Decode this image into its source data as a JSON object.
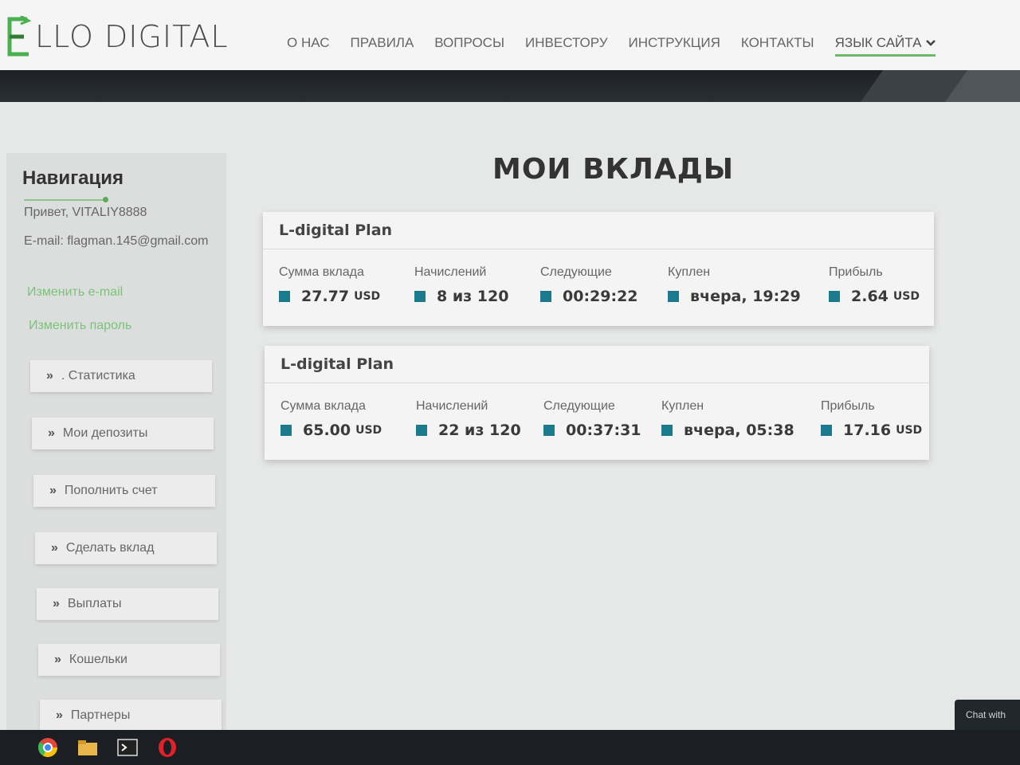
{
  "header": {
    "logo_text": "LLO DIGITAL",
    "nav": [
      "О НАС",
      "ПРАВИЛА",
      "ВОПРОСЫ",
      "ИНВЕСТОРУ",
      "ИНСТРУКЦИЯ",
      "КОНТАКТЫ"
    ],
    "language_label": "ЯЗЫК САЙТА"
  },
  "sidebar": {
    "title": "Навигация",
    "greeting": "Привет, VITALIY8888",
    "email": "E-mail: flagman.145@gmail.com",
    "change_email": "Изменить e-mail",
    "change_password": "Изменить пароль",
    "menu": [
      {
        "label": ". Статистика"
      },
      {
        "label": "Мои депозиты"
      },
      {
        "label": "Пополнить счет"
      },
      {
        "label": "Сделать вклад"
      },
      {
        "label": "Выплаты"
      },
      {
        "label": "Кошельки"
      },
      {
        "label": "Партнеры"
      }
    ]
  },
  "main": {
    "title": "МОИ ВКЛАДЫ",
    "labels": {
      "amount": "Сумма вклада",
      "accruals": "Начислений",
      "next": "Следующие",
      "bought": "Куплен",
      "profit": "Прибыль"
    },
    "deposits": [
      {
        "plan": "L-digital Plan",
        "amount": "27.77",
        "currency": "USD",
        "accruals": "8 из 120",
        "next": "00:29:22",
        "bought": "вчера, 19:29",
        "profit": "2.64"
      },
      {
        "plan": "L-digital Plan",
        "amount": "65.00",
        "currency": "USD",
        "accruals": "22 из 120",
        "next": "00:37:31",
        "bought": "вчера, 05:38",
        "profit": "17.16"
      }
    ]
  },
  "chat_widget": "Chat with",
  "colors": {
    "accent": "#6db96b",
    "marker": "#1a7b8c",
    "band": "#1d2125"
  },
  "taskbar_icons": [
    "chrome-icon",
    "folder-icon",
    "terminal-icon",
    "opera-icon"
  ]
}
